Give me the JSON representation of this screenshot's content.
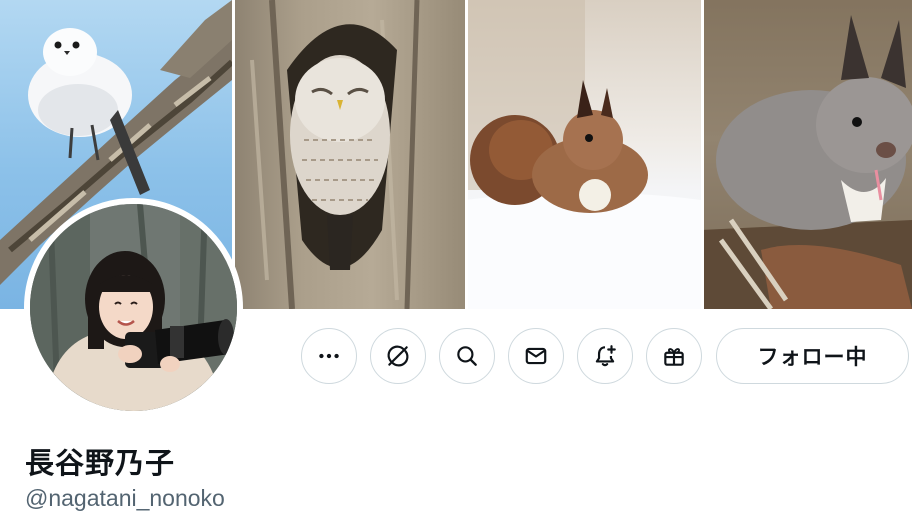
{
  "profile": {
    "display_name": "長谷野乃子",
    "handle": "@nagatani_nonoko"
  },
  "actions": {
    "more_icon": "more-horizontal-icon",
    "grok_icon": "grok-icon",
    "search_icon": "search-icon",
    "message_icon": "envelope-icon",
    "notify_icon": "bell-plus-icon",
    "gift_icon": "gift-icon",
    "follow_label": "フォロー中"
  },
  "colors": {
    "text_primary": "#0f1419",
    "text_secondary": "#536471",
    "button_border": "#cfd9de",
    "background": "#ffffff"
  }
}
